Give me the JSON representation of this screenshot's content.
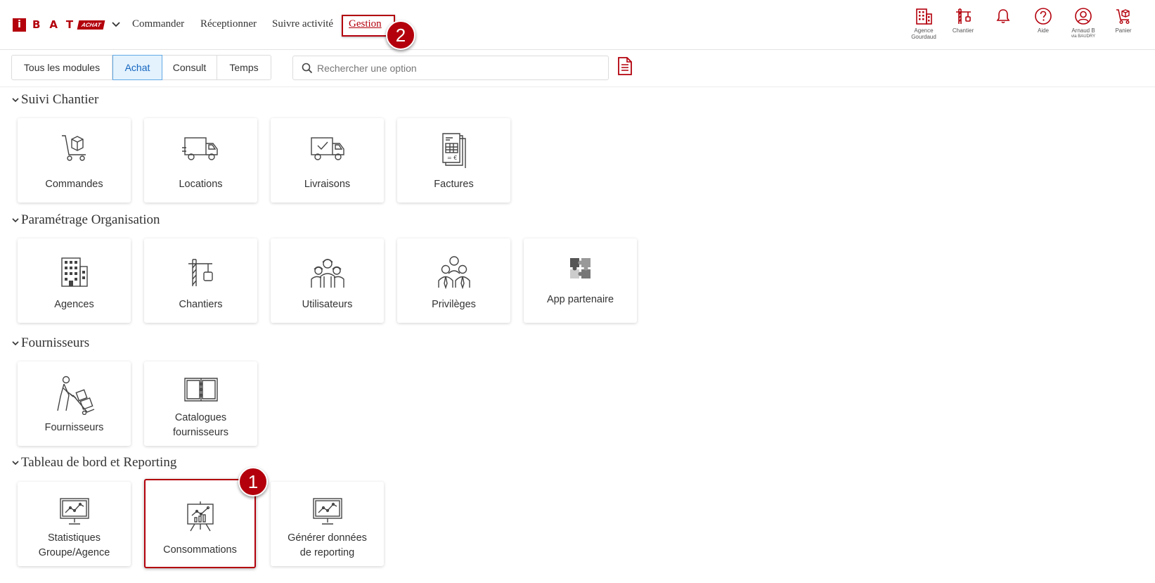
{
  "brand": {
    "letter": "i",
    "name": "BAT",
    "badge": "ACHAT"
  },
  "nav": {
    "commander": "Commander",
    "receptionner": "Réceptionner",
    "suivre": "Suivre activité",
    "gestion": "Gestion"
  },
  "callouts": {
    "one": "1",
    "two": "2"
  },
  "right_icons": {
    "agence": {
      "line1": "Agence",
      "line2": "Gourdaud",
      "icon": "building-icon"
    },
    "chantier": {
      "line1": "Chantier",
      "icon": "crane-icon"
    },
    "notifications": {
      "icon": "bell-icon"
    },
    "aide": {
      "line1": "Aide",
      "icon": "help-icon"
    },
    "user": {
      "line1": "Arnaud B",
      "line2": "via BAUDRY",
      "icon": "user-icon"
    },
    "panier": {
      "line1": "Panier",
      "icon": "cart-icon"
    }
  },
  "tabs": [
    "Tous les modules",
    "Achat",
    "Consult",
    "Temps"
  ],
  "active_tab": "Achat",
  "search": {
    "placeholder": "Rechercher une option",
    "value": ""
  },
  "sections": {
    "suivi": {
      "title": "Suivi Chantier",
      "cards": [
        "Commandes",
        "Locations",
        "Livraisons",
        "Factures"
      ]
    },
    "param": {
      "title": "Paramétrage Organisation",
      "cards": [
        "Agences",
        "Chantiers",
        "Utilisateurs",
        "Privilèges",
        "App partenaire"
      ]
    },
    "fourn": {
      "title": "Fournisseurs",
      "cards": [
        "Fournisseurs",
        "Catalogues",
        "fournisseurs"
      ]
    },
    "tableau": {
      "title": "Tableau de bord et Reporting",
      "cards": [
        "Statistiques",
        "Groupe/Agence",
        "Consommations",
        "Générer données",
        "de reporting"
      ]
    }
  },
  "colors": {
    "brand_red": "#b3000c",
    "active_tab_bg": "#e3f2fd",
    "active_tab_border": "#62a9e5"
  }
}
